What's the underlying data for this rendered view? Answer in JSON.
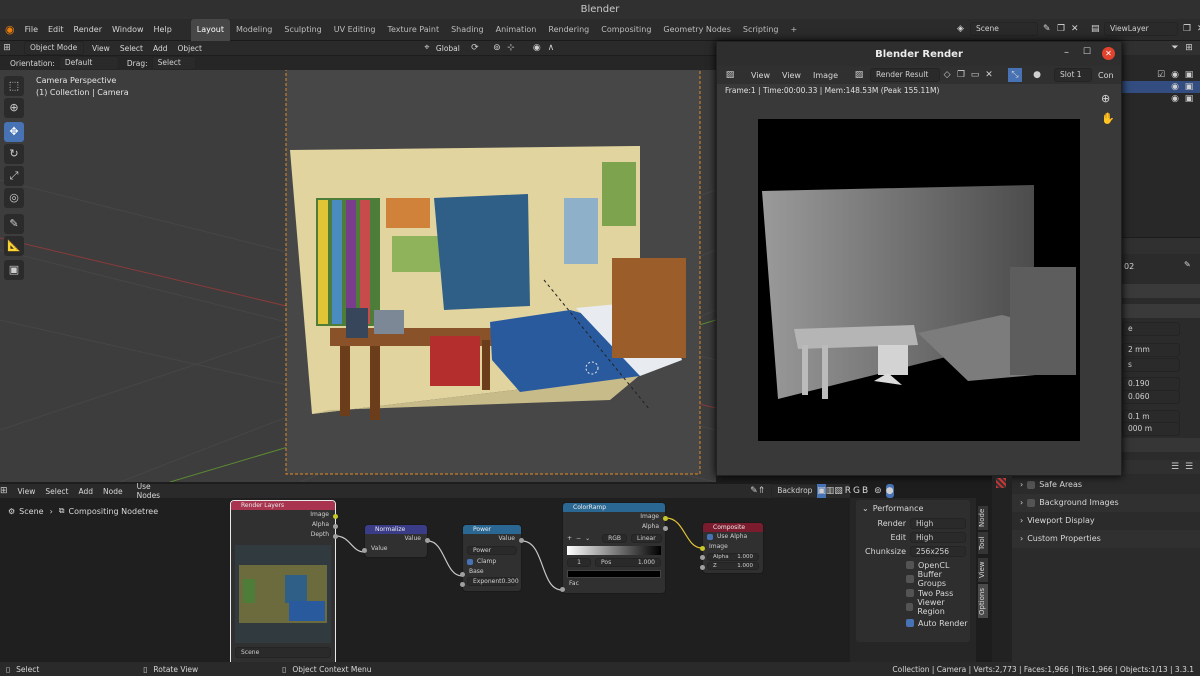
{
  "window": {
    "title": "Blender"
  },
  "menu": {
    "items": [
      "File",
      "Edit",
      "Render",
      "Window",
      "Help"
    ]
  },
  "workspaces": [
    "Layout",
    "Modeling",
    "Sculpting",
    "UV Editing",
    "Texture Paint",
    "Shading",
    "Animation",
    "Rendering",
    "Compositing",
    "Geometry Nodes",
    "Scripting"
  ],
  "scene": {
    "name": "Scene",
    "viewlayer": "ViewLayer"
  },
  "viewport": {
    "mode": "Object Mode",
    "menus": [
      "View",
      "Select",
      "Add",
      "Object"
    ],
    "transform": "Global",
    "orientation_label": "Orientation:",
    "orientation": "Default",
    "drag_label": "Drag:",
    "drag": "Select Box",
    "camera_title": "Camera Perspective",
    "camera_sub": "(1) Collection | Camera"
  },
  "render_window": {
    "title": "Blender Render",
    "menus": [
      "View",
      "View",
      "Image"
    ],
    "image_name": "Render Result",
    "slot": "Slot 1",
    "cut": "Con",
    "info": "Frame:1 | Time:00:00.33 | Mem:148.53M (Peak 155.11M)"
  },
  "node_editor": {
    "menus": [
      "View",
      "Select",
      "Add",
      "Node"
    ],
    "use_nodes": "Use Nodes",
    "backdrop": "Backdrop",
    "channels": [
      "R",
      "G",
      "B"
    ],
    "breadcrumb_scene": "Scene",
    "breadcrumb_tree": "Compositing Nodetree"
  },
  "nodes": {
    "render_layers": {
      "title": "Render Layers",
      "outputs": [
        "Image",
        "Alpha",
        "Depth"
      ],
      "scene": "Scene"
    },
    "normalize": {
      "title": "Normalize",
      "out": "Value",
      "in": "Value"
    },
    "power": {
      "title": "Power",
      "out": "Value",
      "op": "Power",
      "clamp": "Clamp",
      "base": "Base",
      "exponent_label": "Exponent",
      "exponent": "0.300"
    },
    "colorramp": {
      "title": "ColorRamp",
      "outs": [
        "Image",
        "Alpha"
      ],
      "mode": "RGB",
      "interp": "Linear",
      "index": "1",
      "pos_label": "Pos",
      "pos": "1.000",
      "fac": "Fac"
    },
    "composite": {
      "title": "Composite",
      "use_alpha": "Use Alpha",
      "image": "Image",
      "alpha_label": "Alpha",
      "alpha": "1.000",
      "z_label": "Z",
      "z": "1.000"
    }
  },
  "sidebar": {
    "section": "Performance",
    "rows": [
      {
        "label": "Render",
        "value": "High"
      },
      {
        "label": "Edit",
        "value": "High"
      },
      {
        "label": "Chunksize",
        "value": "256x256"
      }
    ],
    "checks": [
      {
        "label": "OpenCL",
        "on": false
      },
      {
        "label": "Buffer Groups",
        "on": false
      },
      {
        "label": "Two Pass",
        "on": false
      },
      {
        "label": "Viewer Region",
        "on": false
      },
      {
        "label": "Auto Render",
        "on": true
      }
    ],
    "tabs": [
      "Node",
      "Tool",
      "View",
      "Options"
    ]
  },
  "properties": {
    "fragments": [
      "02",
      "e",
      "2 mm",
      "s",
      "0.190",
      "0.060",
      "0.1 m",
      "000 m"
    ],
    "panels": [
      "Safe Areas",
      "Background Images",
      "Viewport Display",
      "Custom Properties"
    ]
  },
  "status": {
    "left": [
      {
        "icon": "mouse-left",
        "label": "Select"
      },
      {
        "icon": "mouse-middle",
        "label": "Rotate View"
      },
      {
        "icon": "mouse-right",
        "label": "Object Context Menu"
      }
    ],
    "stats": "Collection | Camera | Verts:2,773 | Faces:1,966 | Tris:1,966 | Objects:1/13 | 3.3.1"
  },
  "colors": {
    "accent": "#4772b3",
    "render_layers": "#a8344f",
    "input_node": "#3b3c88",
    "color_node": "#2a6893",
    "output_node": "#7a1c2e"
  }
}
